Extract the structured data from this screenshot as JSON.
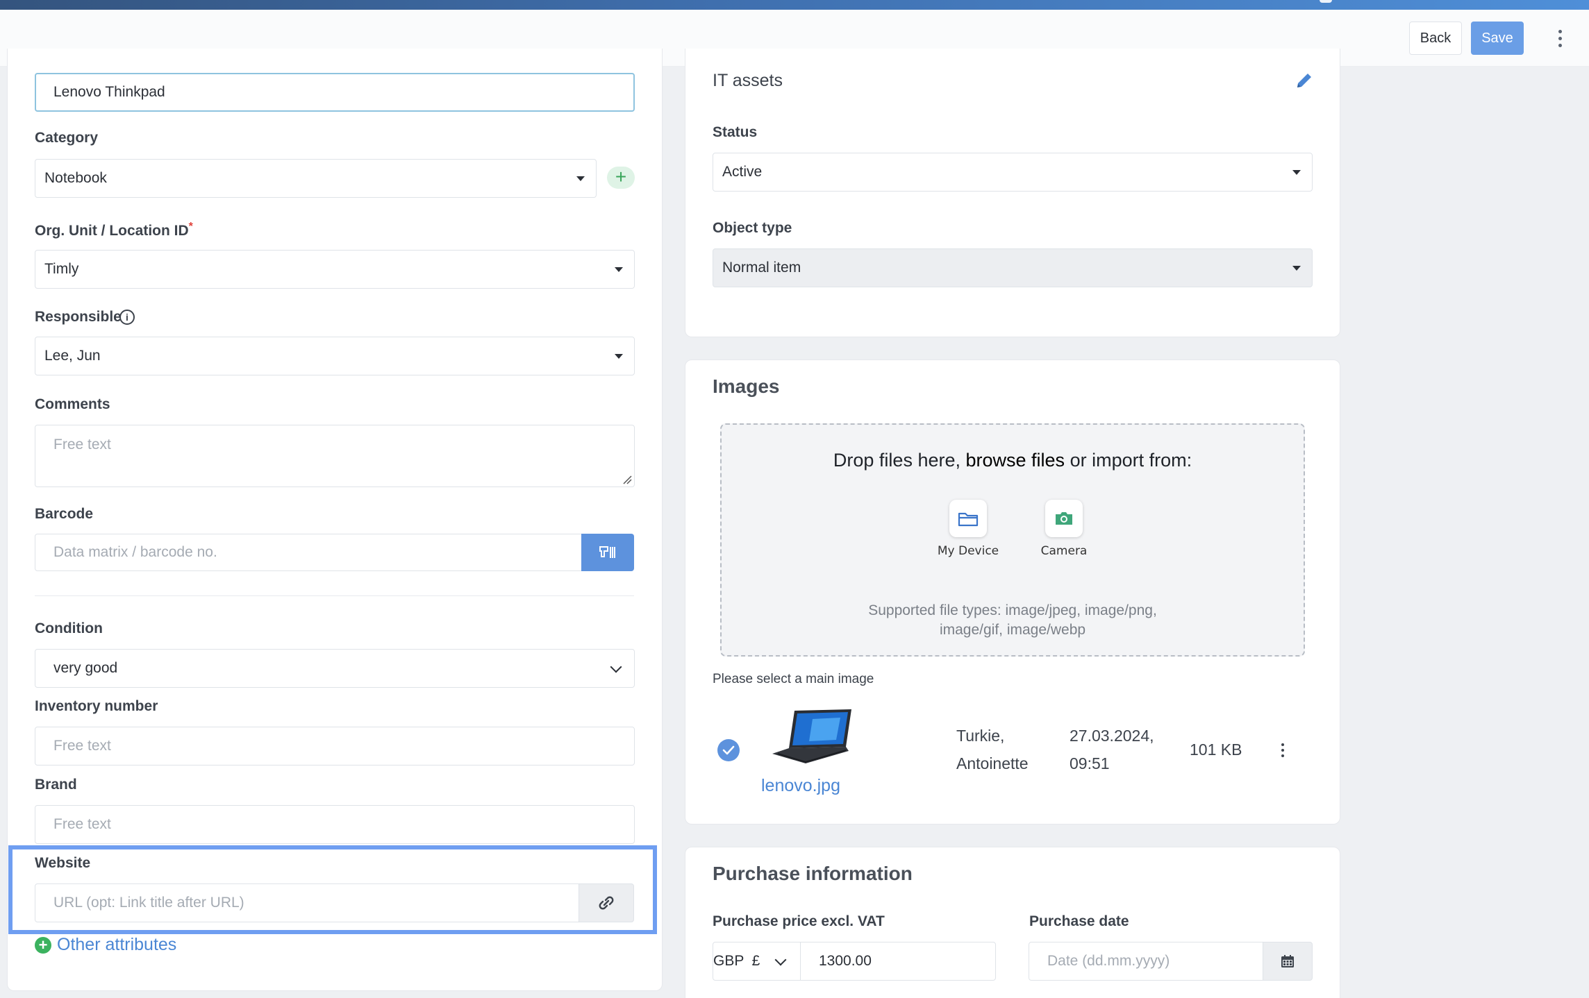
{
  "toolbar": {
    "back_label": "Back",
    "save_label": "Save",
    "more_icon": "kebab-vertical-icon"
  },
  "form": {
    "name_value": "Lenovo Thinkpad",
    "category": {
      "label": "Category",
      "value": "Notebook"
    },
    "org_unit": {
      "label": "Org. Unit / Location ID",
      "required_mark": "*",
      "value": "Timly"
    },
    "responsible": {
      "label": "Responsible",
      "info_icon": "i",
      "value": "Lee, Jun"
    },
    "comments": {
      "label": "Comments",
      "placeholder": "Free text"
    },
    "barcode": {
      "label": "Barcode",
      "placeholder": "Data matrix / barcode no."
    },
    "condition": {
      "label": "Condition",
      "value": "very good"
    },
    "inventory_number": {
      "label": "Inventory number",
      "placeholder": "Free text"
    },
    "brand": {
      "label": "Brand",
      "placeholder": "Free text"
    },
    "website": {
      "label": "Website",
      "placeholder": "URL (opt: Link title after URL)"
    },
    "other_attributes": "Other attributes",
    "add_symbol": "+"
  },
  "type_card": {
    "title": "IT assets",
    "status": {
      "label": "Status",
      "value": "Active"
    },
    "object_type": {
      "label": "Object type",
      "value": "Normal item"
    }
  },
  "images": {
    "title": "Images",
    "drop_prefix": "Drop files here, ",
    "drop_browse": "browse files",
    "drop_suffix": " or import from:",
    "sources": [
      {
        "label": "My Device",
        "icon": "folder-icon"
      },
      {
        "label": "Camera",
        "icon": "camera-icon"
      }
    ],
    "supported_line1": "Supported file types: image/jpeg, image/png,",
    "supported_line2": "image/gif, image/webp",
    "hint": "Please select a main image",
    "file": {
      "name": "lenovo.jpg",
      "uploader_line1": "Turkie,",
      "uploader_line2": "Antoinette",
      "date_line1": "27.03.2024,",
      "date_line2": "09:51",
      "size": "101 KB"
    }
  },
  "purchase": {
    "title": "Purchase information",
    "price": {
      "label": "Purchase price excl. VAT",
      "currency": "GBP  £",
      "value": "1300.00"
    },
    "date": {
      "label": "Purchase date",
      "placeholder": "Date (dd.mm.yyyy)"
    }
  },
  "colors": {
    "accent": "#5d92dd",
    "save_button": "#6a9ee6",
    "highlight_border": "#6f9ef1",
    "add_green": "#3bb25f",
    "link_blue": "#4a86d4"
  }
}
